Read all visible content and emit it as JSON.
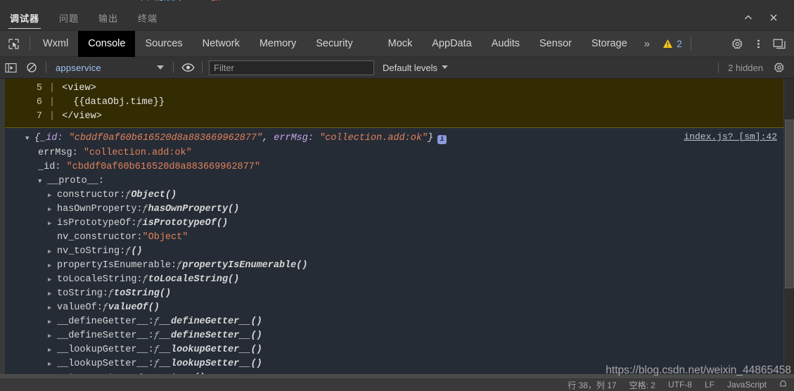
{
  "panel": {
    "tabs": [
      {
        "label": "调试器",
        "active": true
      },
      {
        "label": "问题",
        "active": false
      },
      {
        "label": "输出",
        "active": false
      },
      {
        "label": "终端",
        "active": false
      }
    ],
    "collapse_icon": "chevron-up-icon",
    "close_icon": "close-icon"
  },
  "devtools": {
    "inspect_icon": "inspect-element-icon",
    "tabs": [
      "Wxml",
      "Console",
      "Sources",
      "Network",
      "Memory",
      "Security",
      "Mock",
      "AppData",
      "Audits",
      "Sensor",
      "Storage"
    ],
    "active_tab": "Console",
    "more_label": "»",
    "warning_icon": "warning-triangle-icon",
    "warning_count": "2",
    "settings_icon": "gear-icon",
    "kebab_icon": "more-vertical-icon",
    "dock_icon": "dock-panel-icon"
  },
  "console_toolbar": {
    "sidebar_icon": "console-sidebar-icon",
    "clear_icon": "clear-console-icon",
    "context_selected": "appservice",
    "context_caret": "chevron-down-icon",
    "eye_icon": "live-expression-eye-icon",
    "filter_value": "",
    "filter_placeholder": "Filter",
    "levels_label": "Default levels",
    "levels_caret": "chevron-down-icon",
    "hidden_label": "2 hidden",
    "hidden_settings_icon": "gear-icon"
  },
  "warning_block": {
    "lines": [
      {
        "number": "5",
        "code": "<view>"
      },
      {
        "number": "6",
        "code": "  {{dataObj.time}}"
      },
      {
        "number": "7",
        "code": "</view>"
      }
    ]
  },
  "log_entry": {
    "toggle": "▼",
    "head_open": "{",
    "head_key1": "_id:",
    "head_val1": "\"cbddf0af60b616520d8a883669962877\"",
    "head_comma": ", ",
    "head_key2": "errMsg:",
    "head_val2": "\"collection.add:ok\"",
    "head_close": "}",
    "info_badge": "i",
    "source_link": "index.js? [sm]:42",
    "own_props": [
      {
        "key": "errMsg:",
        "value": "\"collection.add:ok\""
      },
      {
        "key": "_id:",
        "value": "\"cbddf0af60b616520d8a883669962877\""
      }
    ],
    "proto_label": "__proto__:",
    "proto_toggle": "▼",
    "proto_props": [
      {
        "expand": "▶",
        "key": "constructor:",
        "fn": "ƒ",
        "value": "Object()",
        "type": "fn"
      },
      {
        "expand": "▶",
        "key": "hasOwnProperty:",
        "fn": "ƒ",
        "value": "hasOwnProperty()",
        "type": "fn"
      },
      {
        "expand": "▶",
        "key": "isPrototypeOf:",
        "fn": "ƒ",
        "value": "isPrototypeOf()",
        "type": "fn"
      },
      {
        "expand": "",
        "key": "nv_constructor:",
        "fn": "",
        "value": "\"Object\"",
        "type": "str"
      },
      {
        "expand": "▶",
        "key": "nv_toString:",
        "fn": "ƒ",
        "value": "()",
        "type": "fn"
      },
      {
        "expand": "▶",
        "key": "propertyIsEnumerable:",
        "fn": "ƒ",
        "value": "propertyIsEnumerable()",
        "type": "fn"
      },
      {
        "expand": "▶",
        "key": "toLocaleString:",
        "fn": "ƒ",
        "value": "toLocaleString()",
        "type": "fn"
      },
      {
        "expand": "▶",
        "key": "toString:",
        "fn": "ƒ",
        "value": "toString()",
        "type": "fn"
      },
      {
        "expand": "▶",
        "key": "valueOf:",
        "fn": "ƒ",
        "value": "valueOf()",
        "type": "fn"
      },
      {
        "expand": "▶",
        "key": "__defineGetter__:",
        "fn": "ƒ",
        "value": "__defineGetter__()",
        "type": "fn"
      },
      {
        "expand": "▶",
        "key": "__defineSetter__:",
        "fn": "ƒ",
        "value": "__defineSetter__()",
        "type": "fn"
      },
      {
        "expand": "▶",
        "key": "__lookupGetter__:",
        "fn": "ƒ",
        "value": "__lookupGetter__()",
        "type": "fn"
      },
      {
        "expand": "▶",
        "key": "__lookupSetter__:",
        "fn": "ƒ",
        "value": "__lookupSetter__()",
        "type": "fn"
      },
      {
        "expand": "▶",
        "key": "get __proto__:",
        "fn": "ƒ",
        "value": "__proto__()",
        "type": "fn"
      }
    ]
  },
  "watermark": "https://blog.csdn.net/weixin_44865458",
  "statusbar": {
    "items": [
      "行 38，列 17",
      "空格: 2",
      "UTF-8",
      "LF",
      "JavaScript"
    ],
    "bell_icon": "notification-bell-icon"
  },
  "colors": {
    "console_bg": "#262c36",
    "warning_bg": "#332b02",
    "chrome_bg": "#333333",
    "tab_bg": "#3a3a3a",
    "active_tab_bg": "#000000",
    "string_color": "#e0825b",
    "prop_color": "#c5a6e8",
    "link_color": "#9cc4f4",
    "warning_icon_color": "#f5c518"
  }
}
